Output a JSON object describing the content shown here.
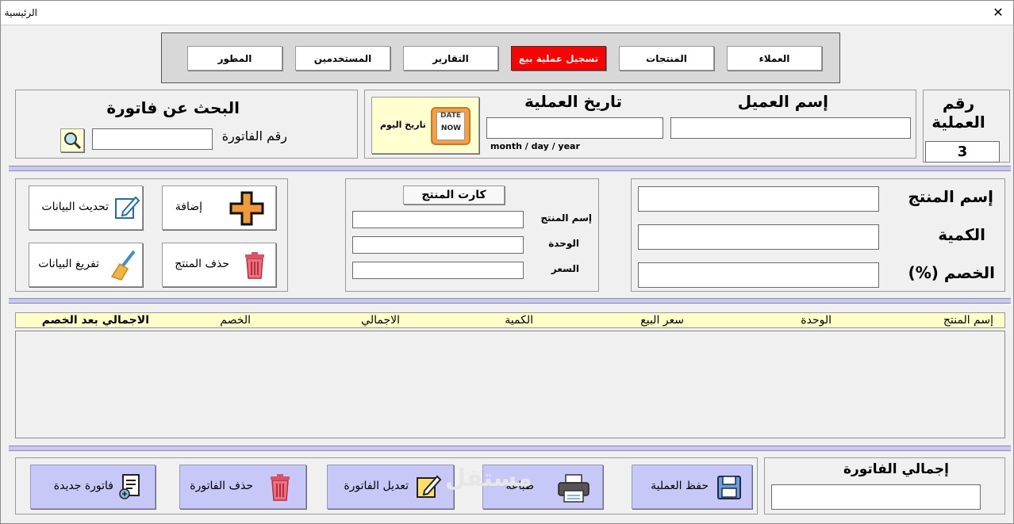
{
  "window": {
    "title": "الرئيسية",
    "close_label": "✕"
  },
  "nav": {
    "items": [
      {
        "label": "العملاء",
        "active": false
      },
      {
        "label": "المنتجات",
        "active": false
      },
      {
        "label": "تسجيل عملية بيع",
        "active": true
      },
      {
        "label": "التقارير",
        "active": false
      },
      {
        "label": "المستخدمين",
        "active": false
      },
      {
        "label": "المطور",
        "active": false
      }
    ]
  },
  "operation": {
    "number_label": "رقم العملية",
    "number_value": "3"
  },
  "customer": {
    "name_label": "إسم العميل",
    "name_value": "",
    "date_label": "تاريخ العملية",
    "date_value": "",
    "date_hint": "month / day / year",
    "today_label": "تاريخ اليوم",
    "date_icon_top": "DATE",
    "date_icon_bottom": "NOW"
  },
  "search": {
    "title": "البحث عن فاتورة",
    "invoice_label": "رقم الفاتورة",
    "invoice_value": ""
  },
  "product_entry": {
    "name_label": "إسم المنتج",
    "qty_label": "الكمية",
    "discount_label": "الخصم (%)",
    "name_value": "",
    "qty_value": "",
    "discount_value": ""
  },
  "product_card": {
    "title": "كارت المنتج",
    "name_label": "إسم المنتج",
    "unit_label": "الوحدة",
    "price_label": "السعر",
    "name_value": "",
    "unit_value": "",
    "price_value": ""
  },
  "actions": {
    "add": "إضافة",
    "update": "تحديث البيانات",
    "delete_product": "حذف المنتج",
    "clear": "تفريغ البيانات"
  },
  "table": {
    "columns": [
      "إسم المنتج",
      "الوحدة",
      "سعر البيع",
      "الكمية",
      "الاجمالي",
      "الخصم",
      "الاجمالي بعد الخصم"
    ],
    "rows": []
  },
  "total": {
    "label": "إجمالي الفاتورة",
    "value": ""
  },
  "bottom": {
    "save": "حفظ العملية",
    "print": "طباعة",
    "edit": "تعديل الفاتورة",
    "delete": "حذف الفاتورة",
    "new": "فاتورة جديدة"
  },
  "watermark": "مستقل"
}
